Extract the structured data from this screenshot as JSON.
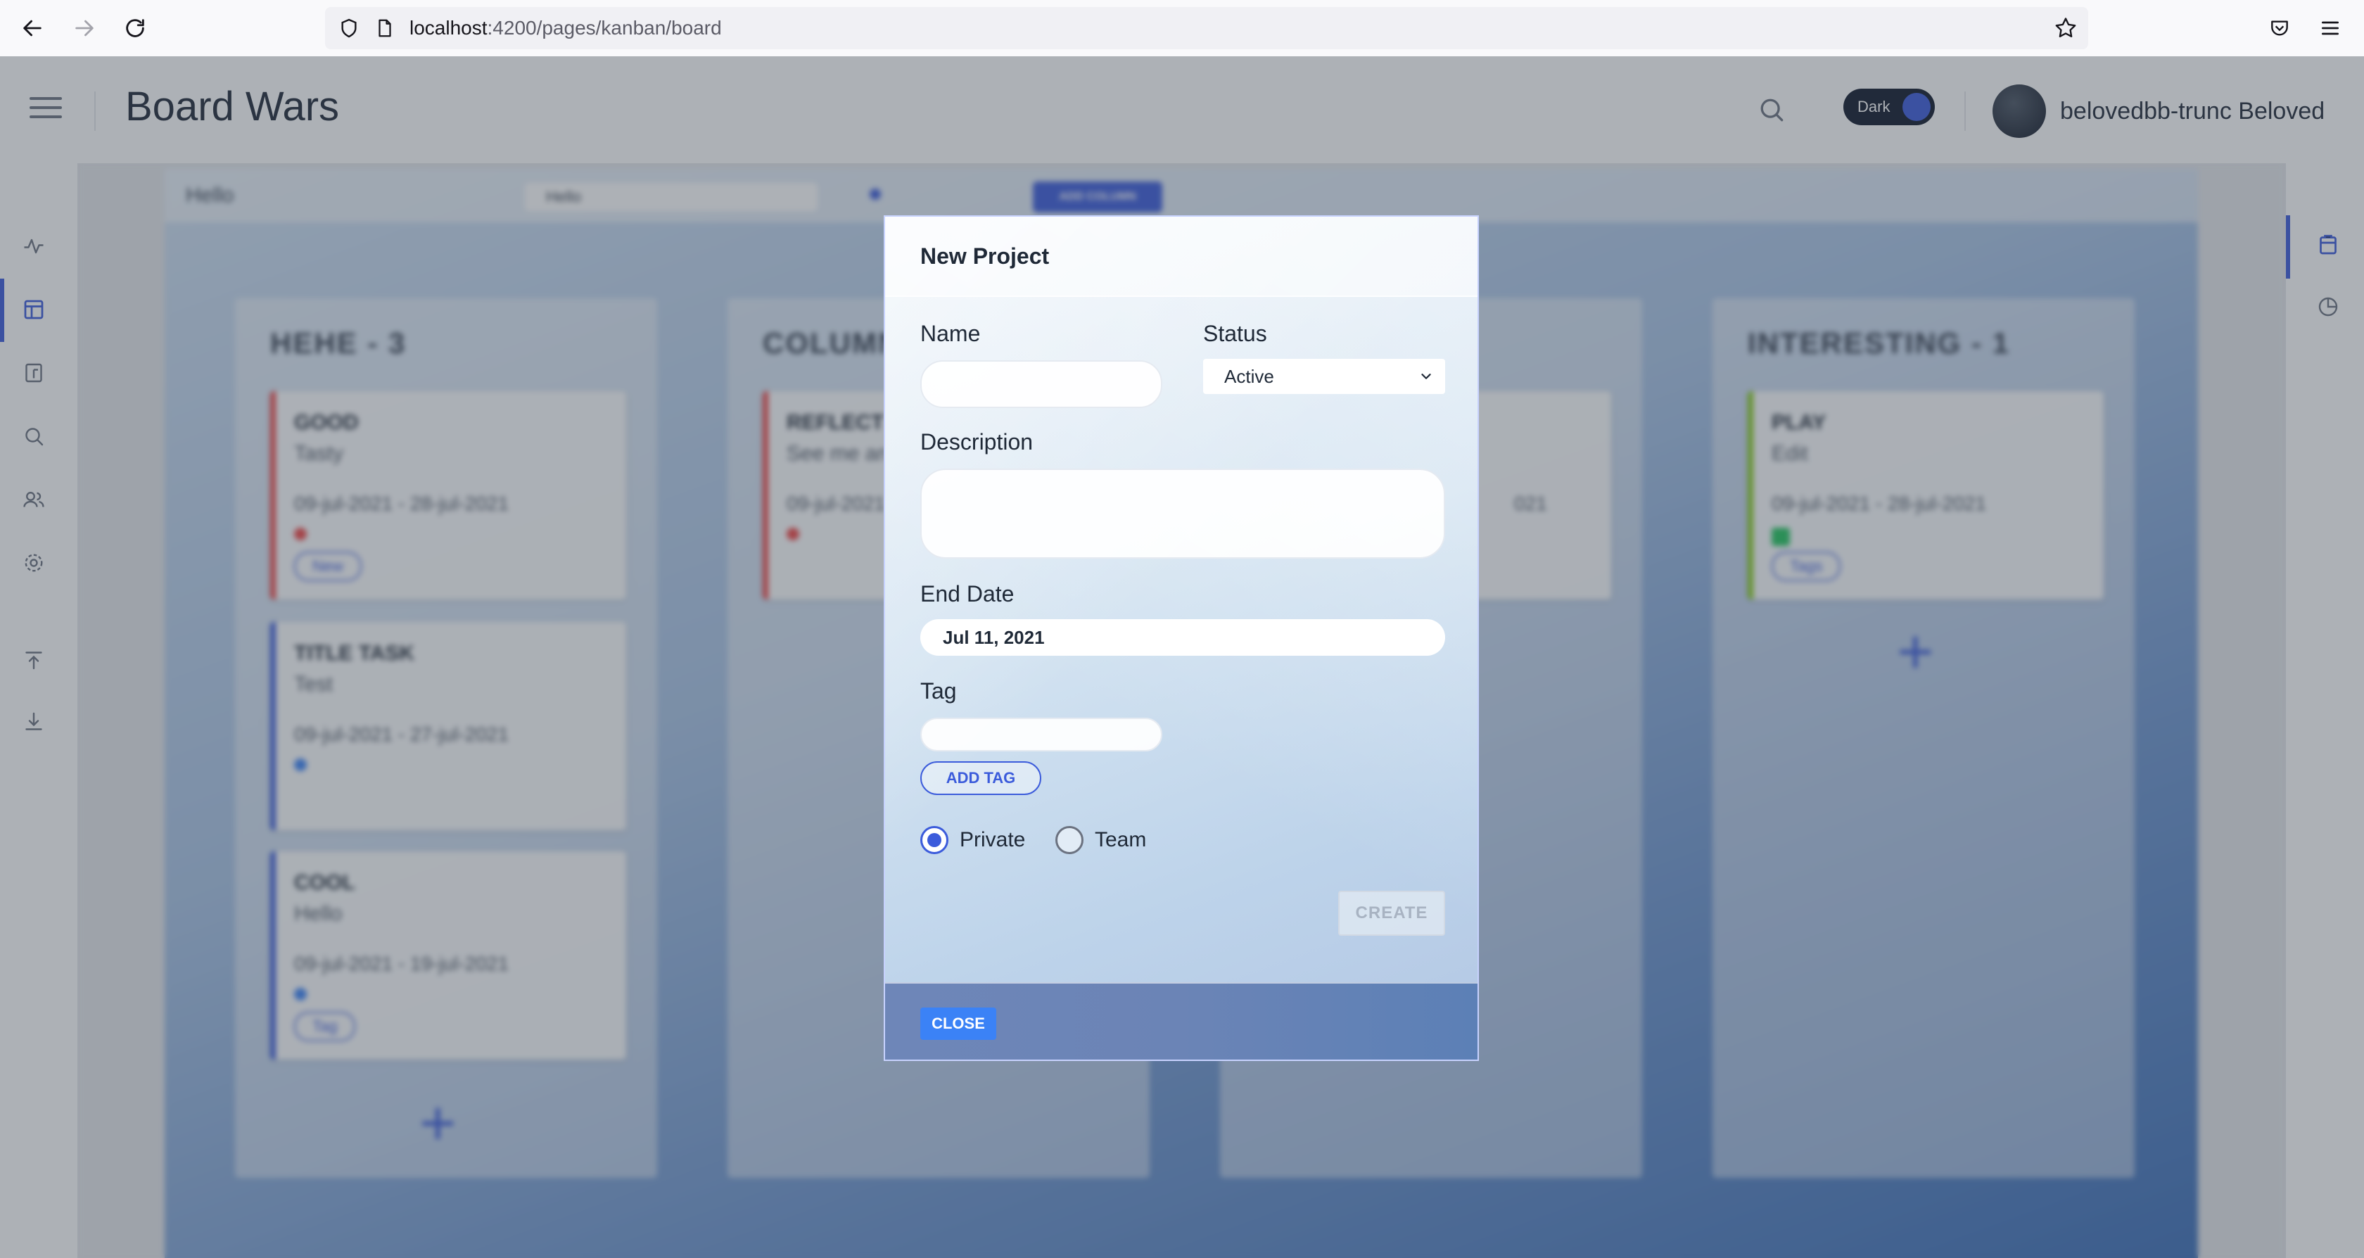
{
  "browser": {
    "url_host": "localhost",
    "url_path": ":4200/pages/kanban/board"
  },
  "header": {
    "title": "Board Wars",
    "theme_label": "Dark",
    "user_name": "belovedbb-trunc Beloved"
  },
  "board": {
    "toolbar_title": "Hello",
    "toolbar_select": "Hello",
    "add_column_label": "ADD COLUMN",
    "columns": [
      {
        "title": "HEHE - 3",
        "cards": [
          {
            "title": "GOOD",
            "subtitle": "Tasty",
            "dates": "09-jul-2021 - 28-jul-2021",
            "tag": "New",
            "accent": "#ef4444",
            "priority": "#ef4444"
          },
          {
            "title": "TITLE TASK",
            "subtitle": "Test",
            "dates": "09-jul-2021 - 27-jul-2021",
            "tag": "",
            "accent": "#3b5bdb",
            "priority": "#3b82f6"
          },
          {
            "title": "COOL",
            "subtitle": "Hello",
            "dates": "09-jul-2021 - 19-jul-2021",
            "tag": "Tag",
            "accent": "#3b5bdb",
            "priority": "#3b82f6"
          }
        ]
      },
      {
        "title": "COLUMN",
        "cards": [
          {
            "title": "REFLECT",
            "subtitle": "See me an",
            "dates": "09-jul-2021",
            "tag": "",
            "accent": "#ef4444",
            "priority": "#ef4444"
          }
        ]
      },
      {
        "title": "",
        "cards": [
          {
            "title": "",
            "subtitle": "",
            "dates": "021",
            "tag": "",
            "accent": "#3b5bdb",
            "priority": "#3b82f6"
          }
        ]
      },
      {
        "title": "INTERESTING - 1",
        "cards": [
          {
            "title": "PLAY",
            "subtitle": "Edit",
            "dates": "09-jul-2021 - 28-jul-2021",
            "tag": "Tags",
            "accent": "#84cc16",
            "priority": "#22c55e"
          }
        ]
      }
    ]
  },
  "modal": {
    "title": "New Project",
    "name_label": "Name",
    "name_value": "",
    "status_label": "Status",
    "status_value": "Active",
    "description_label": "Description",
    "description_value": "",
    "end_date_label": "End Date",
    "end_date_value": "Jul 11, 2021",
    "tag_label": "Tag",
    "tag_value": "",
    "add_tag_label": "ADD TAG",
    "visibility_options": [
      {
        "label": "Private",
        "checked": true
      },
      {
        "label": "Team",
        "checked": false
      }
    ],
    "create_label": "CREATE",
    "close_label": "CLOSE"
  },
  "colors": {
    "accent": "#3b5bdb",
    "close_button": "#3b82f6"
  }
}
